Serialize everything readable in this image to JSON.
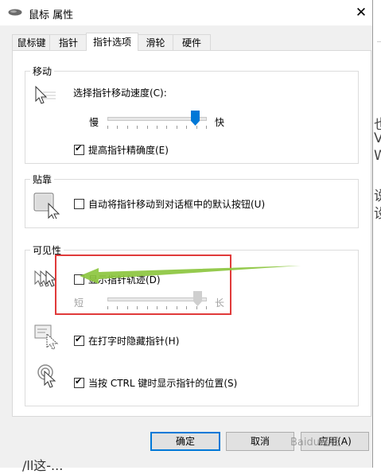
{
  "window": {
    "title": "鼠标 属性",
    "close_glyph": "✕"
  },
  "tabs": [
    {
      "label": "鼠标键",
      "active": false
    },
    {
      "label": "指针",
      "active": false
    },
    {
      "label": "指针选项",
      "active": true
    },
    {
      "label": "滑轮",
      "active": false
    },
    {
      "label": "硬件",
      "active": false
    }
  ],
  "motion": {
    "title": "移动",
    "speed_label": "选择指针移动速度(C):",
    "slow_label": "慢",
    "fast_label": "快",
    "speed_level": 0.92,
    "precision_label": "提高指针精确度(E)",
    "precision_checked": true
  },
  "snap": {
    "title": "贴靠",
    "snap_label": "自动将指针移动到对话框中的默认按钮(U)",
    "snap_checked": false
  },
  "visibility": {
    "title": "可见性",
    "trails_label": "显示指针轨迹(D)",
    "trails_checked": false,
    "short_label": "短",
    "long_label": "长",
    "trail_level": 0.95,
    "hide_label": "在打字时隐藏指针(H)",
    "hide_checked": true,
    "ctrl_label": "当按 CTRL 键时显示指针的位置(S)",
    "ctrl_checked": true
  },
  "buttons": {
    "ok": "确定",
    "cancel": "取消",
    "apply": "应用(A)"
  },
  "desktop": {
    "right_chars": [
      "也",
      "Vi",
      "W",
      "说",
      "设"
    ],
    "bottom_text": "/ll这-..."
  },
  "watermark": "Baidu经验",
  "colors": {
    "accent": "#0078d7",
    "annotation_box": "#e03a3a",
    "annotation_arrow": "#8cc63f"
  }
}
